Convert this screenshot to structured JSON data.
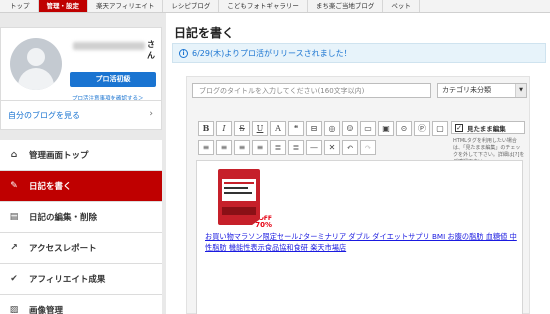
{
  "topnav": {
    "tabs": [
      "トップ",
      "管理・設定",
      "楽天アフィリエイト",
      "レシピブログ",
      "こどもフォトギャラリー",
      "まち楽ご当地ブログ",
      "ペット"
    ],
    "active_index": 1
  },
  "profile": {
    "suffix": "さん",
    "pro_button": "プロ活初級",
    "pro_link": "プロ活注意事項を確認する＞"
  },
  "sidebar": {
    "my_blog": "自分のブログを見る",
    "menu": [
      {
        "label": "管理画面トップ",
        "icon": "home-icon"
      },
      {
        "label": "日記を書く",
        "icon": "pencil-icon",
        "active": true
      },
      {
        "label": "日記の編集・削除",
        "icon": "document-icon"
      },
      {
        "label": "アクセスレポート",
        "icon": "trend-icon"
      },
      {
        "label": "アフィリエイト成果",
        "icon": "wrench-icon"
      },
      {
        "label": "画像管理",
        "icon": "image-icon"
      }
    ]
  },
  "main": {
    "title": "日記を書く",
    "notice": "6/29(木)よりプロ活がリリースされました！",
    "title_placeholder": "ブログのタイトルを入力してください(160文字以内)",
    "category": "カテゴリ未分類",
    "raw_edit_label": "見たまま編集",
    "raw_edit_note": "HTMLタグを利用したい場合は、「見たまま編集」のチェックを外して下さい。詳細は[?]をご確認下さい。",
    "toolbar_row1": [
      "B",
      "I",
      "S",
      "U",
      "A",
      "❝",
      "⊟",
      "◎",
      "☺",
      "▭",
      "▣",
      "⊙",
      "Ⓟ",
      "▢"
    ],
    "toolbar_row2": [
      "≡",
      "≡",
      "≡",
      "≡",
      "≣",
      "≣",
      "—",
      "✕",
      "↶",
      "↷"
    ],
    "badge_off": "OFF",
    "badge_percent": "70%",
    "product_link": "お買い物マラソン限定セール♪ターミナリア ダブル ダイエットサプリ BMI お腹の脂肪 血糖値 中性脂肪 機能性表示食品協和食研 楽天市場店"
  }
}
